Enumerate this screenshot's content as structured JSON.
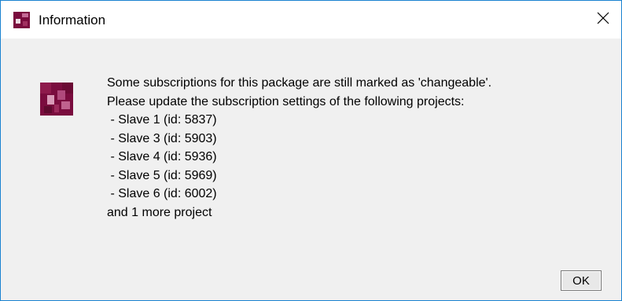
{
  "window": {
    "title": "Information",
    "icon": "app-logo-icon",
    "close_icon": "close-icon",
    "colors": {
      "border": "#1a82d0",
      "icon_dark": "#7a0c3e",
      "icon_light": "#c56a96"
    }
  },
  "message": {
    "icon": "info-icon",
    "lines": [
      "Some subscriptions for this package are still marked as 'changeable'.",
      "Please update the subscription settings of the following projects:",
      " - Slave 1 (id: 5837)",
      " - Slave 3 (id: 5903)",
      " - Slave 4 (id: 5936)",
      " - Slave 5 (id: 5969)",
      " - Slave 6 (id: 6002)",
      "and 1 more project"
    ]
  },
  "buttons": {
    "ok_label": "OK"
  }
}
